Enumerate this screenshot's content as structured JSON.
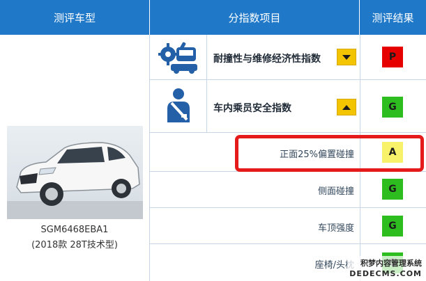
{
  "header": {
    "col1": "测评车型",
    "col2": "分指数项目",
    "col3": "测评结果"
  },
  "vehicle": {
    "model": "SGM6468EBA1",
    "variant": "(2018款 28T技术型)"
  },
  "categories": [
    {
      "icon": "repair-tools-icon",
      "title": "耐撞性与维修经济性指数",
      "toggle": "expand",
      "grade": "P",
      "grade_color": "#e60000"
    },
    {
      "icon": "seatbelt-passenger-icon",
      "title": "车内乘员安全指数",
      "toggle": "collapse",
      "grade": "G",
      "grade_color": "#2dbd1f"
    }
  ],
  "subitems": [
    {
      "title": "正面25%偏置碰撞",
      "grade": "A",
      "grade_color": "#f7f26a"
    },
    {
      "title": "侧面碰撞",
      "grade": "G",
      "grade_color": "#2dbd1f"
    },
    {
      "title": "车顶强度",
      "grade": "G",
      "grade_color": "#2dbd1f"
    },
    {
      "title": "座椅/头枕",
      "grade": "G",
      "grade_color": "#2dbd1f"
    }
  ],
  "colors": {
    "header_bg": "#1f78c8",
    "highlight": "#e51b1b",
    "toggle": "#f2c500",
    "icon_blue": "#2460a7"
  },
  "watermark": {
    "line1": "积梦内容管理系统",
    "line2": "DEDECMS.COM"
  }
}
